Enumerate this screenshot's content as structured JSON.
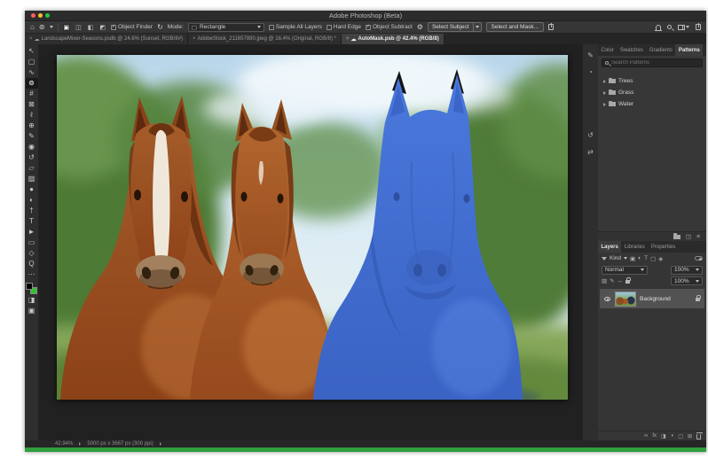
{
  "window": {
    "title": "Adobe Photoshop (Beta)"
  },
  "icons": {
    "home": "⌂",
    "tool_preset": "⊚",
    "refresh": "↻",
    "gear": "⚙",
    "cloud": "☁",
    "close": "×",
    "mode_new": "▣",
    "mode_add": "◫",
    "mode_subtract": "◧",
    "mode_intersect": "◩",
    "mode_shape": "▢",
    "check": "✓",
    "ellipsis": "⋯"
  },
  "options_bar": {
    "object_finder_label": "Object Finder",
    "mode_label": "Mode:",
    "mode_value": "Rectangle",
    "sample_all_layers_label": "Sample All Layers",
    "hard_edge_label": "Hard Edge",
    "object_subtract_label": "Object Subtract",
    "select_subject_label": "Select Subject",
    "select_and_mask_label": "Select and Mask..."
  },
  "document_tabs": [
    {
      "label": "LandscapeMixer-Seasons.psdb @ 24.6% (Sunset, RGB/8#)"
    },
    {
      "label": "AdobeStock_211657890.jpeg @ 16.4% (Original, RGB/8) *"
    },
    {
      "label": "AutoMask.psb @ 42.4% (RGB/8)"
    }
  ],
  "toolbar": {
    "tools": [
      {
        "name": "move",
        "glyph": "↖"
      },
      {
        "name": "rectangular-marquee",
        "glyph": "▢"
      },
      {
        "name": "lasso",
        "glyph": "∿"
      },
      {
        "name": "object-selection",
        "glyph": "⊚"
      },
      {
        "name": "crop",
        "glyph": "#"
      },
      {
        "name": "frame",
        "glyph": "⊠"
      },
      {
        "name": "eyedropper",
        "glyph": "ℓ"
      },
      {
        "name": "spot-healing-brush",
        "glyph": "⊕"
      },
      {
        "name": "brush",
        "glyph": "✎"
      },
      {
        "name": "clone-stamp",
        "glyph": "◉"
      },
      {
        "name": "history-brush",
        "glyph": "↺"
      },
      {
        "name": "eraser",
        "glyph": "▱"
      },
      {
        "name": "gradient",
        "glyph": "▨"
      },
      {
        "name": "blur",
        "glyph": "●"
      },
      {
        "name": "dodge",
        "glyph": "◐"
      },
      {
        "name": "pen",
        "glyph": "†"
      },
      {
        "name": "type",
        "glyph": "T"
      },
      {
        "name": "path-selection",
        "glyph": "►"
      },
      {
        "name": "rectangle-shape",
        "glyph": "▭"
      },
      {
        "name": "hand",
        "glyph": "◇"
      },
      {
        "name": "zoom",
        "glyph": "Q"
      }
    ],
    "edit_toolbar_glyph": "⋯",
    "foreground_color": "#000000",
    "background_color": "#2fc22f",
    "quick_mask_glyph": "◨",
    "screen_mode_glyph": "▣"
  },
  "side_strip": {
    "icons": [
      "✎",
      "◔",
      "↺",
      "⇄"
    ]
  },
  "patterns_panel": {
    "tabs": [
      "Color",
      "Swatches",
      "Gradients",
      "Patterns"
    ],
    "active_tab": "Patterns",
    "search_placeholder": "Search Patterns",
    "folders": [
      "Trees",
      "Grass",
      "Water"
    ]
  },
  "layers_panel": {
    "tabs": [
      "Layers",
      "Libraries",
      "Properties"
    ],
    "active_tab": "Layers",
    "filter_label": "Kind",
    "filter_icons": [
      "▣",
      "◐",
      "T",
      "▢",
      "◈"
    ],
    "blend_mode": "Normal",
    "opacity": "100%",
    "lock_icons": [
      "▨",
      "✎",
      "↔"
    ],
    "fill": "100%",
    "footer_icons": [
      "∞",
      "fx",
      "◨",
      "◑",
      "▢",
      "⊞"
    ],
    "layer": {
      "name": "Background"
    }
  },
  "status_bar": {
    "zoom_level": "42.94%",
    "doc_info": "5000 px x 3667 px (300 ppi)"
  }
}
